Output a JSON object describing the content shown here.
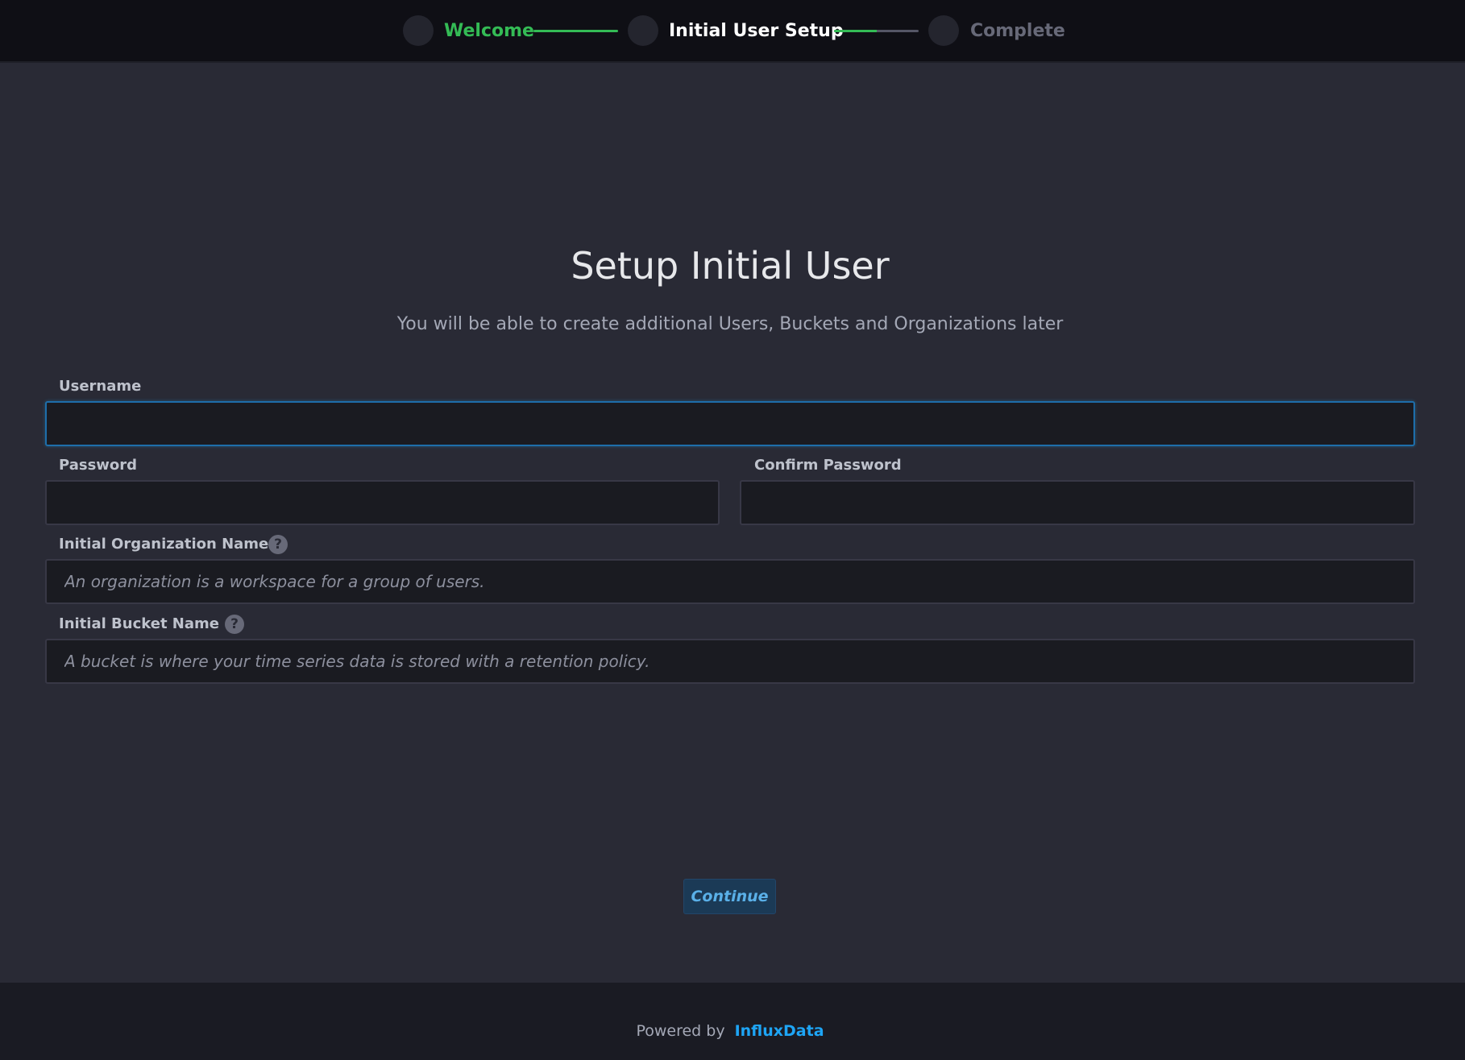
{
  "stepper": {
    "steps": [
      {
        "label": "Welcome",
        "state": "completed",
        "color": "#34bb55"
      },
      {
        "label": "Initial User Setup",
        "state": "current",
        "color": "#ffffff"
      },
      {
        "label": "Complete",
        "state": "upcoming",
        "color": "#676978"
      }
    ],
    "connectors": [
      {
        "progress": 1.0
      },
      {
        "progress": 0.5
      }
    ]
  },
  "form": {
    "title": "Setup Initial User",
    "subtitle": "You will be able to create additional Users, Buckets and Organizations later",
    "username": {
      "label": "Username",
      "value": "",
      "placeholder": ""
    },
    "password": {
      "label": "Password",
      "value": "",
      "placeholder": ""
    },
    "confirm_password": {
      "label": "Confirm Password",
      "value": "",
      "placeholder": ""
    },
    "organization": {
      "label": "Initial Organization Name",
      "value": "",
      "placeholder": "An organization is a workspace for a group of users.",
      "help_icon": "question-circle-icon",
      "help_glyph": "?"
    },
    "bucket": {
      "label": "Initial Bucket Name",
      "value": "",
      "placeholder": "A bucket is where your time series data is stored with a retention policy.",
      "help_icon": "question-circle-icon",
      "help_glyph": "?"
    },
    "continue_label": "Continue"
  },
  "footer": {
    "powered_by": "Powered by",
    "brand": "InfluxData"
  },
  "colors": {
    "accent_green": "#34bb55",
    "accent_blue": "#1ea5f5",
    "background": "#292a35"
  }
}
